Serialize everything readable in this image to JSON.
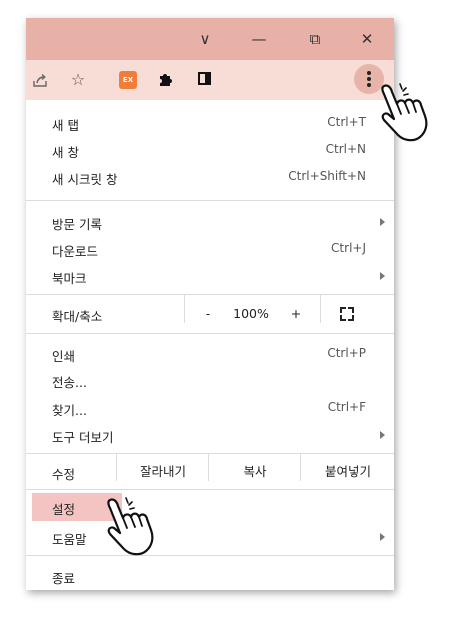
{
  "window": {
    "controls": {
      "chevron": "∨",
      "minimize": "—",
      "restore": "⧉",
      "close": "✕"
    }
  },
  "toolbar": {
    "icons": [
      "share-icon",
      "star-icon",
      "extension-ex-icon",
      "puzzle-icon",
      "side-panel-icon",
      "more-menu-icon"
    ],
    "ext_badge": "EX",
    "accent_color": "#e8b1a7",
    "toolbar_color": "#f8dcd6"
  },
  "menu": {
    "new_tab": {
      "label": "새 탭",
      "shortcut": "Ctrl+T"
    },
    "new_window": {
      "label": "새 창",
      "shortcut": "Ctrl+N"
    },
    "incognito": {
      "label": "새 시크릿 창",
      "shortcut": "Ctrl+Shift+N"
    },
    "history": {
      "label": "방문 기록"
    },
    "downloads": {
      "label": "다운로드",
      "shortcut": "Ctrl+J"
    },
    "bookmarks": {
      "label": "북마크"
    },
    "zoom": {
      "label": "확대/축소",
      "minus": "-",
      "value": "100%",
      "plus": "+"
    },
    "print": {
      "label": "인쇄",
      "shortcut": "Ctrl+P"
    },
    "cast": {
      "label": "전송..."
    },
    "find": {
      "label": "찾기...",
      "shortcut": "Ctrl+F"
    },
    "more_tools": {
      "label": "도구 더보기"
    },
    "edit": {
      "label": "수정",
      "cut": "잘라내기",
      "copy": "복사",
      "paste": "붙여넣기"
    },
    "settings": {
      "label": "설정",
      "highlight_color": "#f3c4c2"
    },
    "help": {
      "label": "도움말"
    },
    "exit": {
      "label": "종료"
    }
  }
}
